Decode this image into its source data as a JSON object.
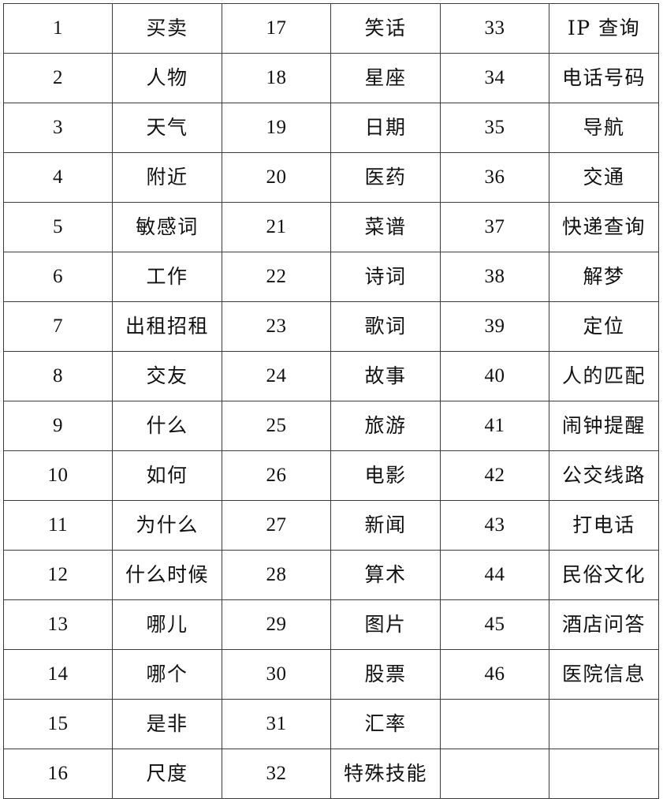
{
  "document": {
    "type": "table",
    "description": "Six-column numbered category list table",
    "columns": 6,
    "rows": 16,
    "column_headers": [
      "",
      "",
      "",
      "",
      "",
      ""
    ],
    "border_color": "#3c3c3c",
    "background_color": "#ffffff",
    "text_color": "#111111"
  },
  "table": {
    "rows": [
      {
        "c1": "1",
        "c2": "买卖",
        "c3": "17",
        "c4": "笑话",
        "c5": "33",
        "c6": "IP 查询"
      },
      {
        "c1": "2",
        "c2": "人物",
        "c3": "18",
        "c4": "星座",
        "c5": "34",
        "c6": "电话号码"
      },
      {
        "c1": "3",
        "c2": "天气",
        "c3": "19",
        "c4": "日期",
        "c5": "35",
        "c6": "导航"
      },
      {
        "c1": "4",
        "c2": "附近",
        "c3": "20",
        "c4": "医药",
        "c5": "36",
        "c6": "交通"
      },
      {
        "c1": "5",
        "c2": "敏感词",
        "c3": "21",
        "c4": "菜谱",
        "c5": "37",
        "c6": "快递查询"
      },
      {
        "c1": "6",
        "c2": "工作",
        "c3": "22",
        "c4": "诗词",
        "c5": "38",
        "c6": "解梦"
      },
      {
        "c1": "7",
        "c2": "出租招租",
        "c3": "23",
        "c4": "歌词",
        "c5": "39",
        "c6": "定位"
      },
      {
        "c1": "8",
        "c2": "交友",
        "c3": "24",
        "c4": "故事",
        "c5": "40",
        "c6": "人的匹配"
      },
      {
        "c1": "9",
        "c2": "什么",
        "c3": "25",
        "c4": "旅游",
        "c5": "41",
        "c6": "闹钟提醒"
      },
      {
        "c1": "10",
        "c2": "如何",
        "c3": "26",
        "c4": "电影",
        "c5": "42",
        "c6": "公交线路"
      },
      {
        "c1": "11",
        "c2": "为什么",
        "c3": "27",
        "c4": "新闻",
        "c5": "43",
        "c6": "打电话"
      },
      {
        "c1": "12",
        "c2": "什么时候",
        "c3": "28",
        "c4": "算术",
        "c5": "44",
        "c6": "民俗文化"
      },
      {
        "c1": "13",
        "c2": "哪儿",
        "c3": "29",
        "c4": "图片",
        "c5": "45",
        "c6": "酒店问答"
      },
      {
        "c1": "14",
        "c2": "哪个",
        "c3": "30",
        "c4": "股票",
        "c5": "46",
        "c6": "医院信息"
      },
      {
        "c1": "15",
        "c2": "是非",
        "c3": "31",
        "c4": "汇率",
        "c5": "",
        "c6": ""
      },
      {
        "c1": "16",
        "c2": "尺度",
        "c3": "32",
        "c4": "特殊技能",
        "c5": "",
        "c6": ""
      }
    ]
  }
}
